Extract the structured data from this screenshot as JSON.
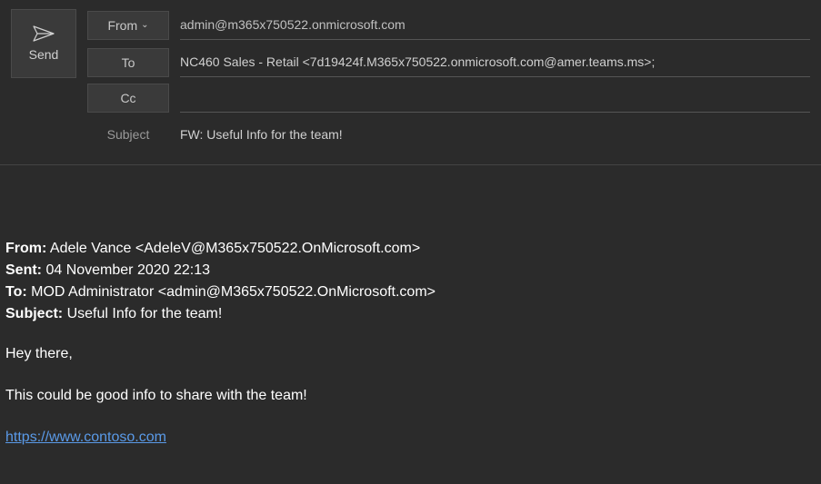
{
  "compose": {
    "send_label": "Send",
    "from_label": "From",
    "from_value": "admin@m365x750522.onmicrosoft.com",
    "to_label": "To",
    "to_value": "NC460 Sales - Retail <7d19424f.M365x750522.onmicrosoft.com@amer.teams.ms>;",
    "cc_label": "Cc",
    "cc_value": "",
    "subject_label": "Subject",
    "subject_value": "FW: Useful Info for the team!"
  },
  "quoted": {
    "from_label": "From:",
    "from_value": " Adele Vance <AdeleV@M365x750522.OnMicrosoft.com>",
    "sent_label": "Sent:",
    "sent_value": " 04 November 2020 22:13",
    "to_label": "To:",
    "to_value": " MOD Administrator <admin@M365x750522.OnMicrosoft.com>",
    "subject_label": "Subject:",
    "subject_value": " Useful Info for the team!"
  },
  "body": {
    "greeting": "Hey there,",
    "line1": "This could be good info to share with the team!",
    "link_text": "https://www.contoso.com"
  }
}
